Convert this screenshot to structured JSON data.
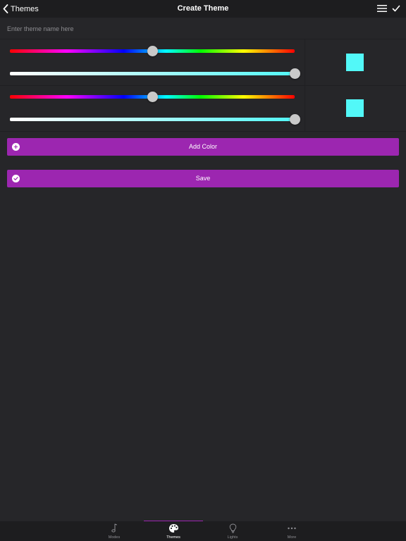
{
  "nav": {
    "back_label": "Themes",
    "title": "Create Theme"
  },
  "name_field": {
    "placeholder": "Enter theme name here",
    "value": ""
  },
  "colors": [
    {
      "hue_position": 0.5,
      "brightness_position": 1.0,
      "swatch_color": "#52f8f8"
    },
    {
      "hue_position": 0.5,
      "brightness_position": 1.0,
      "swatch_color": "#52f8f8"
    }
  ],
  "actions": {
    "add_color_label": "Add Color",
    "save_label": "Save"
  },
  "accent_color": "#9c26b0",
  "tabs": [
    {
      "label": "Modes",
      "icon": "music-note-icon",
      "active": false
    },
    {
      "label": "Themes",
      "icon": "palette-icon",
      "active": true
    },
    {
      "label": "Lights",
      "icon": "lightbulb-icon",
      "active": false
    },
    {
      "label": "More",
      "icon": "more-dots-icon",
      "active": false
    }
  ]
}
